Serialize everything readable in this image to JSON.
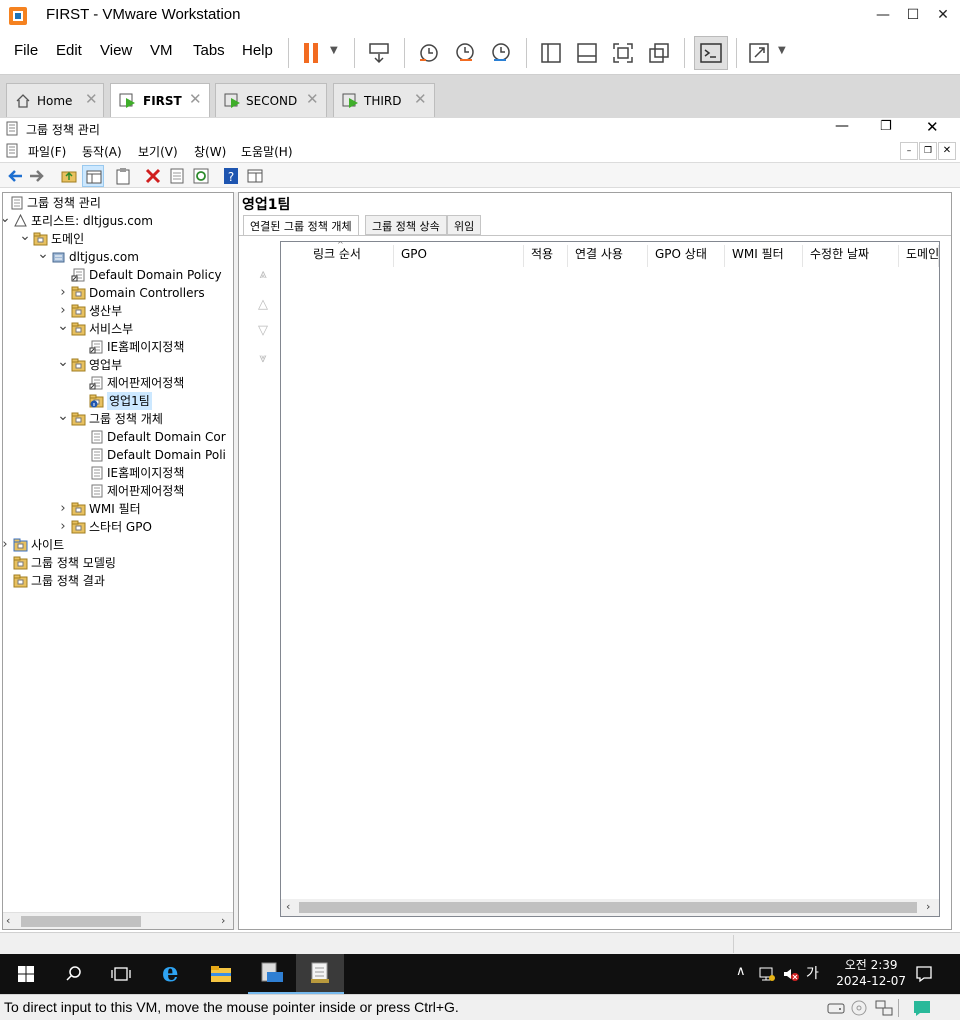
{
  "vmware": {
    "title": "FIRST - VMware Workstation",
    "menu": [
      "File",
      "Edit",
      "View",
      "VM",
      "Tabs",
      "Help"
    ],
    "tabs": [
      {
        "label": "Home",
        "icon": "home-icon"
      },
      {
        "label": "FIRST",
        "icon": "vm-icon"
      },
      {
        "label": "SECOND",
        "icon": "vm-icon"
      },
      {
        "label": "THIRD",
        "icon": "vm-icon"
      }
    ],
    "active_tab": "FIRST",
    "status_message": "To direct input to this VM, move the mouse pointer inside or press Ctrl+G.",
    "accent_color": "#ff6a00"
  },
  "mmc": {
    "title": "그룹 정책 관리",
    "menu": [
      "파일(F)",
      "동작(A)",
      "보기(V)",
      "창(W)",
      "도움말(H)"
    ],
    "tree": [
      {
        "label": "그룹 정책 관리",
        "level": 0,
        "expander": "",
        "icon": "gpm-icon"
      },
      {
        "label": "포리스트: dltjgus.com",
        "level": 1,
        "expander": "v",
        "icon": "forest-icon"
      },
      {
        "label": "도메인",
        "level": 2,
        "expander": "v",
        "icon": "domains-icon"
      },
      {
        "label": "dltjgus.com",
        "level": 3,
        "expander": "v",
        "icon": "domain-icon"
      },
      {
        "label": "Default Domain Policy",
        "level": 4,
        "expander": "",
        "icon": "gpo-link-icon"
      },
      {
        "label": "Domain Controllers",
        "level": 4,
        "expander": ">",
        "icon": "ou-icon"
      },
      {
        "label": "생산부",
        "level": 4,
        "expander": ">",
        "icon": "ou-icon"
      },
      {
        "label": "서비스부",
        "level": 4,
        "expander": "v",
        "icon": "ou-icon"
      },
      {
        "label": "IE홈페이지정책",
        "level": 5,
        "expander": "",
        "icon": "gpo-link-icon"
      },
      {
        "label": "영업부",
        "level": 4,
        "expander": "v",
        "icon": "ou-icon"
      },
      {
        "label": "제어판제어정책",
        "level": 5,
        "expander": "",
        "icon": "gpo-link-icon"
      },
      {
        "label": "영업1팀",
        "level": 5,
        "expander": "",
        "icon": "ou-info-icon",
        "selected": true
      },
      {
        "label": "그룹 정책 개체",
        "level": 4,
        "expander": "v",
        "icon": "gpo-folder-icon"
      },
      {
        "label": "Default Domain Cor",
        "level": 5,
        "expander": "",
        "icon": "gpo-icon"
      },
      {
        "label": "Default Domain Poli",
        "level": 5,
        "expander": "",
        "icon": "gpo-icon"
      },
      {
        "label": "IE홈페이지정책",
        "level": 5,
        "expander": "",
        "icon": "gpo-icon"
      },
      {
        "label": "제어판제어정책",
        "level": 5,
        "expander": "",
        "icon": "gpo-icon"
      },
      {
        "label": "WMI 필터",
        "level": 4,
        "expander": ">",
        "icon": "wmi-folder-icon"
      },
      {
        "label": "스타터 GPO",
        "level": 4,
        "expander": ">",
        "icon": "starter-gpo-icon"
      },
      {
        "label": "사이트",
        "level": 1,
        "expander": ">",
        "icon": "sites-icon"
      },
      {
        "label": "그룹 정책 모델링",
        "level": 1,
        "expander": "",
        "icon": "modeling-icon"
      },
      {
        "label": "그룹 정책 결과",
        "level": 1,
        "expander": "",
        "icon": "results-icon"
      }
    ],
    "right": {
      "title": "영업1팀",
      "tabs": [
        "연결된 그룹 정책 개체",
        "그룹 정책 상속",
        "위임"
      ],
      "columns": [
        "링크 순서",
        "GPO",
        "적용",
        "연결 사용",
        "GPO 상태",
        "WMI 필터",
        "수정한 날짜",
        "도메인"
      ]
    }
  },
  "taskbar": {
    "time": "오전 2:39",
    "date": "2024-12-07",
    "ime": "가"
  }
}
